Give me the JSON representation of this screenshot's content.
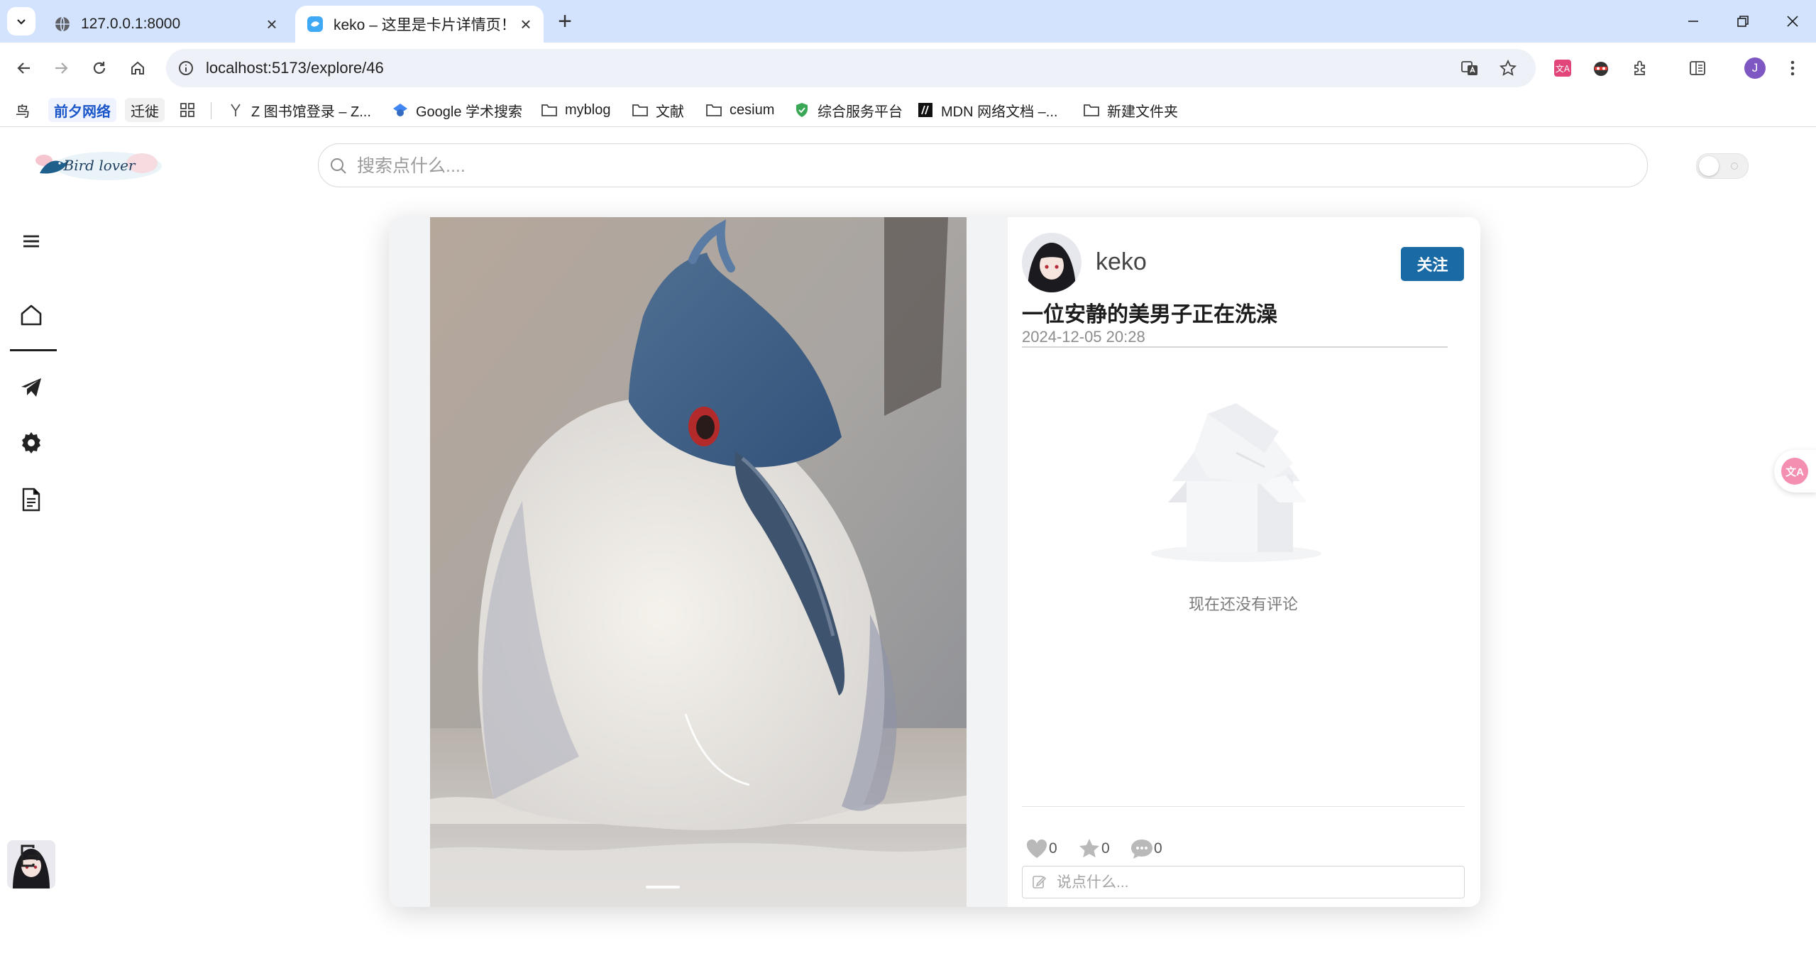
{
  "browser": {
    "tabs": [
      {
        "title": "127.0.0.1:8000",
        "active": false
      },
      {
        "title": "keko – 这里是卡片详情页！",
        "active": true
      }
    ],
    "url": "localhost:5173/explore/46",
    "profile_initial": "J",
    "bookmarks": [
      {
        "label": "鸟",
        "icon": "text-bookmark"
      },
      {
        "label": "前夕网络",
        "icon": "text-bookmark"
      },
      {
        "label": "迁徙",
        "icon": "text-bookmark"
      },
      {
        "label": "",
        "icon": "apps-grid-icon"
      },
      {
        "label": "Z 图书馆登录 – Z...",
        "icon": "z-library-icon"
      },
      {
        "label": "Google 学术搜索",
        "icon": "google-scholar-icon"
      },
      {
        "label": "myblog",
        "icon": "folder-icon"
      },
      {
        "label": "文献",
        "icon": "folder-icon"
      },
      {
        "label": "cesium",
        "icon": "folder-icon"
      },
      {
        "label": "综合服务平台",
        "icon": "shield-icon"
      },
      {
        "label": "MDN 网络文档 –...",
        "icon": "mdn-icon"
      },
      {
        "label": "新建文件夹",
        "icon": "folder-icon"
      }
    ]
  },
  "app": {
    "logo_text": "Bird lover",
    "search_placeholder": "搜索点什么....",
    "sidebar": [
      "menu-icon",
      "home-icon",
      "send-icon",
      "settings-icon",
      "document-icon",
      "logout-icon"
    ]
  },
  "post": {
    "author": "keko",
    "follow_label": "关注",
    "title": "一位安静的美男子正在洗澡",
    "date": "2024-12-05 20:28",
    "empty_comments_text": "现在还没有评论",
    "likes": "0",
    "favorites": "0",
    "comments": "0",
    "comment_placeholder": "说点什么..."
  },
  "colors": {
    "tab_strip": "#d3e3fd",
    "follow_button": "#1a6aa5",
    "card_left_bg": "#f2f3f5"
  }
}
